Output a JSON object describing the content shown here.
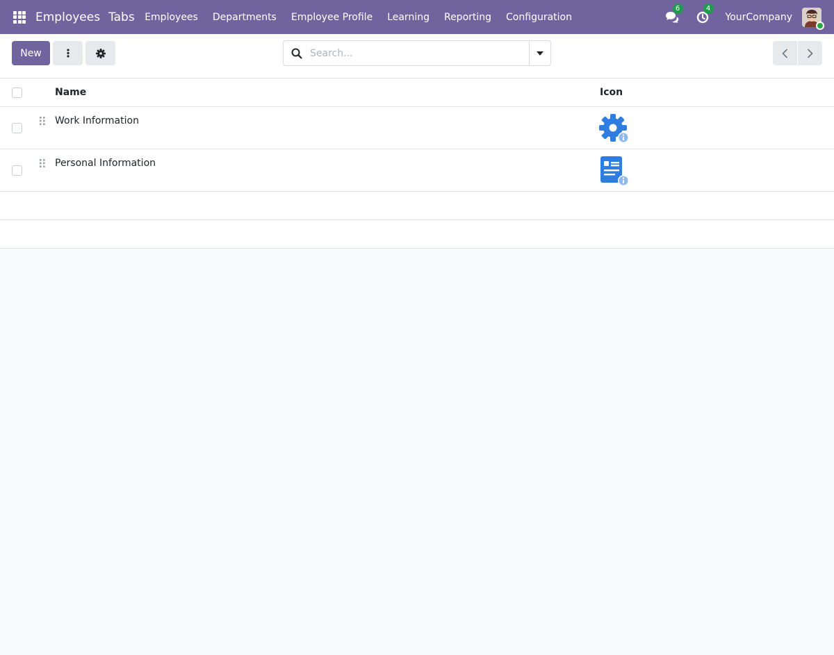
{
  "navbar": {
    "app_name": "Employees",
    "section": "Tabs",
    "menu": [
      {
        "label": "Employees"
      },
      {
        "label": "Departments"
      },
      {
        "label": "Employee Profile"
      },
      {
        "label": "Learning"
      },
      {
        "label": "Reporting"
      },
      {
        "label": "Configuration"
      }
    ],
    "messages_count": "6",
    "activities_count": "4",
    "company": "YourCompany",
    "bar_color": "#71639e",
    "badge_color": "#1e9c4b"
  },
  "control_panel": {
    "new_label": "New",
    "search_placeholder": "Search...",
    "search_value": ""
  },
  "list": {
    "columns": [
      {
        "label": "Name"
      },
      {
        "label": "Icon"
      }
    ],
    "rows": [
      {
        "name": "Work Information",
        "icon": "gear-info-icon"
      },
      {
        "name": "Personal Information",
        "icon": "document-info-icon"
      }
    ],
    "icon_color": "#2f7de1"
  }
}
